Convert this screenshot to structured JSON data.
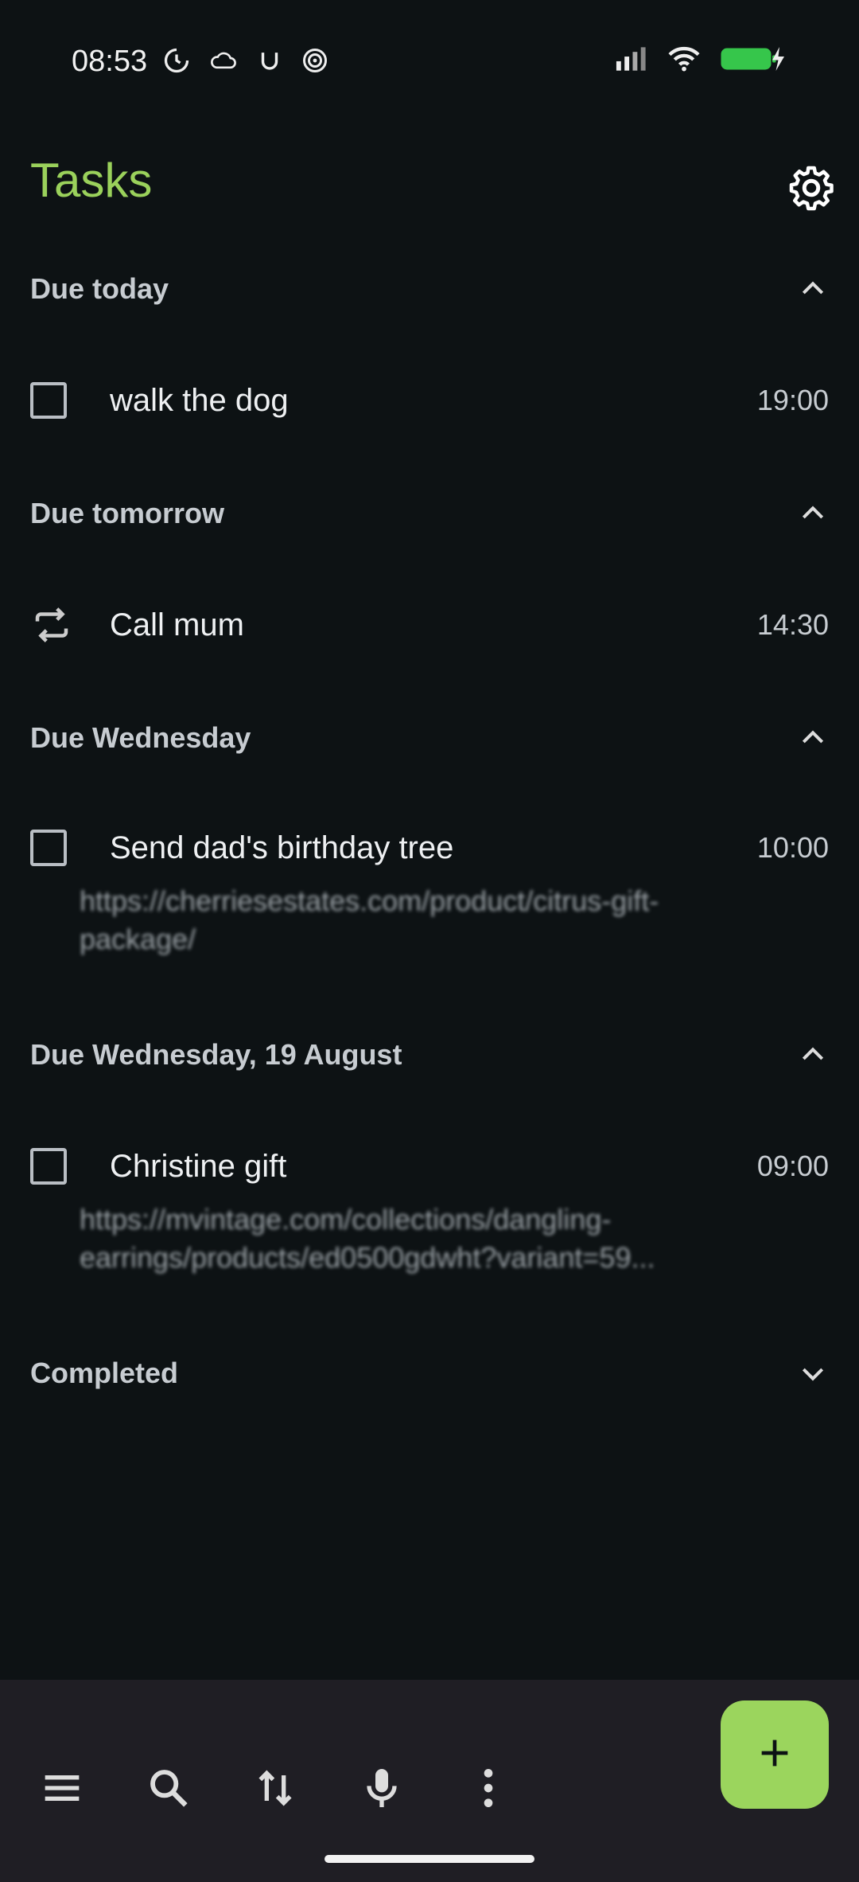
{
  "status": {
    "time": "08:53",
    "icons": [
      "clock-sync-icon",
      "cloud-icon",
      "u-icon",
      "spiral-icon"
    ],
    "right_icons": [
      "signal-icon",
      "wifi-icon",
      "battery-charging-icon"
    ]
  },
  "header": {
    "title": "Tasks"
  },
  "sections": [
    {
      "title": "Due today",
      "chevron": "chevron-up-icon"
    },
    {
      "title": "Due tomorrow",
      "chevron": "chevron-up-icon"
    },
    {
      "title": "Due Wednesday",
      "chevron": "chevron-up-icon"
    },
    {
      "title": "Due Wednesday, 19 August",
      "chevron": "chevron-up-icon"
    },
    {
      "title": "Completed",
      "chevron": "chevron-down-icon"
    }
  ],
  "tasks": [
    {
      "title": "walk the dog",
      "time": "19:00",
      "icon": "checkbox"
    },
    {
      "title": "Call mum",
      "time": "14:30",
      "icon": "repeat-icon"
    },
    {
      "title": "Send dad's birthday tree",
      "time": "10:00",
      "icon": "checkbox",
      "note": "https://cherriesestates.com/product/citrus-gift-package/"
    },
    {
      "title": "Christine gift",
      "time": "09:00",
      "icon": "checkbox",
      "note": "https://mvintage.com/collections/dangling-earrings/products/ed0500gdwht?variant=59..."
    }
  ],
  "toolbar": {
    "items": [
      "menu-icon",
      "search-icon",
      "sort-icon",
      "mic-icon",
      "more-vert-icon"
    ],
    "fab": "add-icon"
  },
  "colors": {
    "accent": "#9ad15b",
    "background": "#0d1214",
    "bottom_bar": "#1f1e24",
    "fab": "#9bd55d"
  }
}
